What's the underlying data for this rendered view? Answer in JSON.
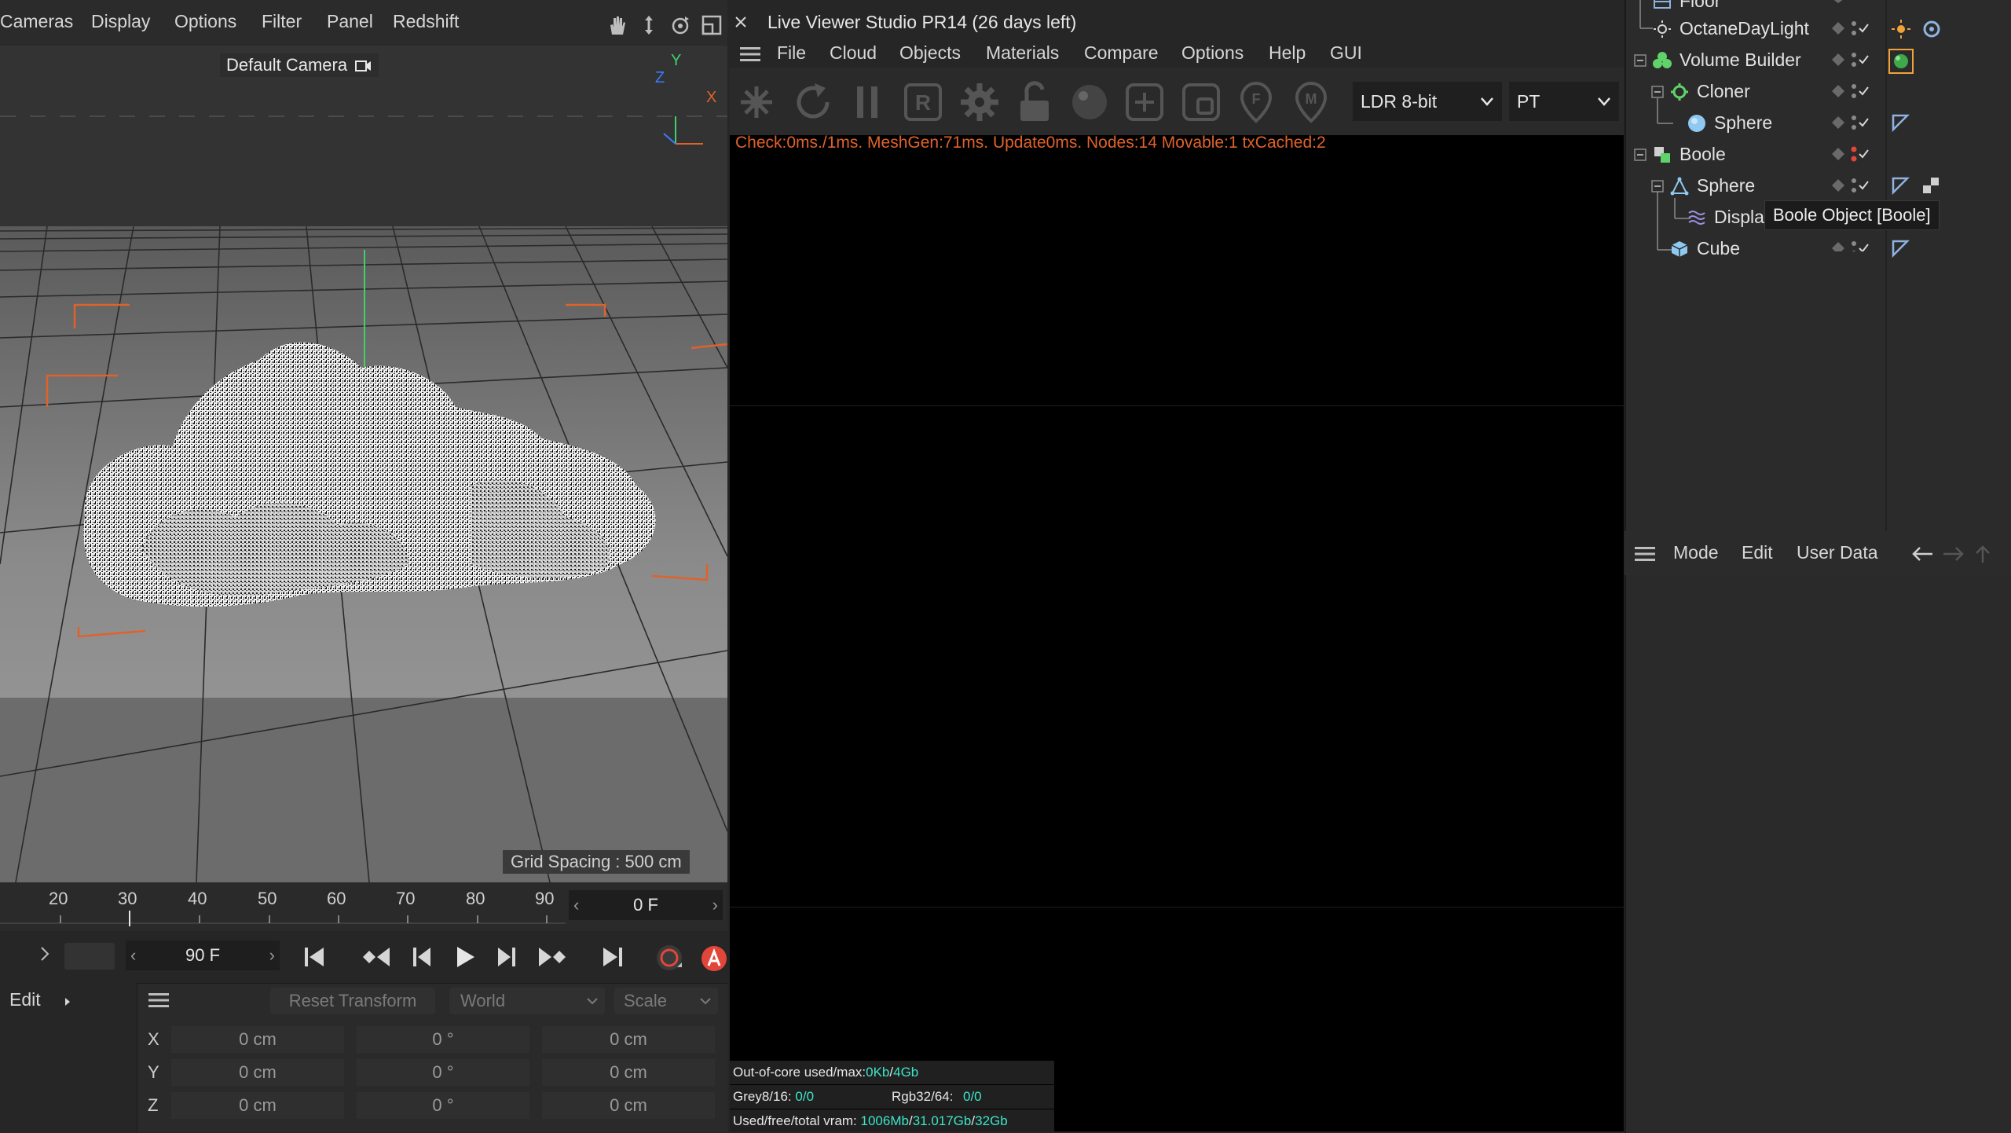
{
  "viewport": {
    "menu": [
      "Cameras",
      "Display",
      "Options",
      "Filter",
      "Panel",
      "Redshift"
    ],
    "camera_label": "Default Camera",
    "axis_labels": {
      "y": "Y",
      "z": "Z",
      "x": "X"
    },
    "grid_spacing": "Grid Spacing : 500 cm"
  },
  "timeline": {
    "ruler": [
      "20",
      "30",
      "40",
      "50",
      "60",
      "70",
      "80",
      "90"
    ],
    "current_frame": "0 F",
    "end_frame": "90 F"
  },
  "coordinates": {
    "edit_label": "Edit",
    "reset_transform": "Reset Transform",
    "space": "World",
    "mode": "Scale",
    "rows": [
      {
        "axis": "X",
        "pos": "0 cm",
        "rot": "0 °",
        "size": "0 cm"
      },
      {
        "axis": "Y",
        "pos": "0 cm",
        "rot": "0 °",
        "size": "0 cm"
      },
      {
        "axis": "Z",
        "pos": "0 cm",
        "rot": "0 °",
        "size": "0 cm"
      }
    ]
  },
  "live_viewer": {
    "title": "Live Viewer Studio PR14 (26 days left)",
    "menu": [
      "File",
      "Cloud",
      "Objects",
      "Materials",
      "Compare",
      "Options",
      "Help",
      "GUI"
    ],
    "ldr_select": "LDR 8-bit",
    "kernel_select": "PT",
    "status_line": "Check:0ms./1ms. MeshGen:71ms. Update0ms. Nodes:14 Movable:1 txCached:2",
    "stats": {
      "ooc_label": "Out-of-core used/max:",
      "ooc_used": "0Kb",
      "ooc_sep": "/",
      "ooc_max": "4Gb",
      "grey_label": "Grey8/16:",
      "grey_value": "0/0",
      "rgb_label": "Rgb32/64:",
      "rgb_value": "0/0",
      "vram_label": "Used/free/total vram:",
      "vram_used": "1006Mb",
      "vram_free": "31.017Gb",
      "vram_total": "32Gb"
    }
  },
  "object_manager": {
    "rows": [
      {
        "label": "Floor"
      },
      {
        "label": "OctaneDayLight"
      },
      {
        "label": "Volume Builder"
      },
      {
        "label": "Cloner"
      },
      {
        "label": "Sphere"
      },
      {
        "label": "Boole"
      },
      {
        "label": "Sphere"
      },
      {
        "label": "Displa"
      },
      {
        "label": "Cube"
      }
    ],
    "tooltip": "Boole Object [Boole]"
  },
  "attribute_manager": {
    "menu": [
      "Mode",
      "Edit",
      "User Data"
    ]
  },
  "colors": {
    "accent_orange": "#e0622a",
    "stat_cyan": "#3ce6c8",
    "record_red": "#e2463b"
  }
}
